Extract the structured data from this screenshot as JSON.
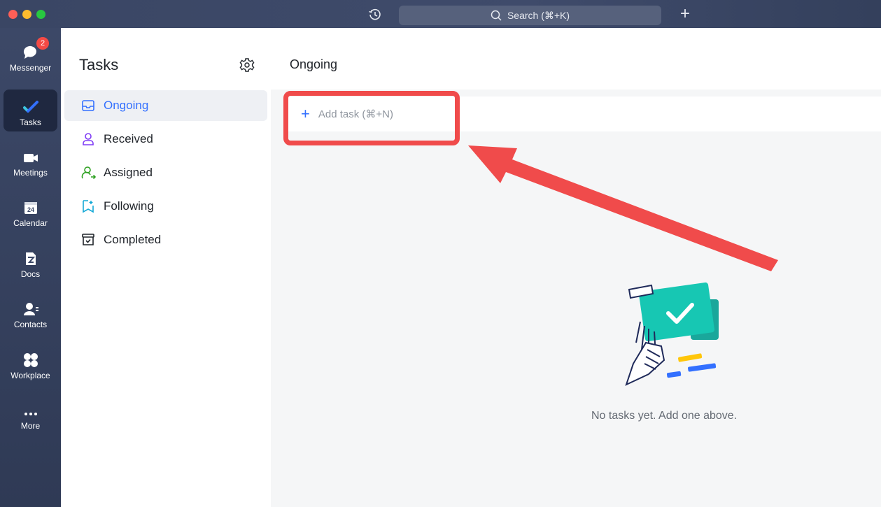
{
  "titlebar": {
    "search_label": "Search (⌘+K)",
    "icons": [
      "history-icon",
      "search-icon",
      "plus-icon"
    ]
  },
  "rail": {
    "items": [
      {
        "label": "Messenger",
        "icon": "messenger-icon",
        "badge": "2"
      },
      {
        "label": "Tasks",
        "icon": "tasks-icon",
        "active": true
      },
      {
        "label": "Meetings",
        "icon": "meetings-icon"
      },
      {
        "label": "Calendar",
        "icon": "calendar-icon",
        "icon_text": "24"
      },
      {
        "label": "Docs",
        "icon": "docs-icon"
      },
      {
        "label": "Contacts",
        "icon": "contacts-icon"
      },
      {
        "label": "Workplace",
        "icon": "workplace-icon"
      },
      {
        "label": "More",
        "icon": "more-icon"
      }
    ]
  },
  "panel": {
    "title": "Tasks",
    "items": [
      {
        "label": "Ongoing",
        "icon": "inbox-icon",
        "active": true
      },
      {
        "label": "Received",
        "icon": "person-icon"
      },
      {
        "label": "Assigned",
        "icon": "person-arrow-icon"
      },
      {
        "label": "Following",
        "icon": "bookmark-plus-icon"
      },
      {
        "label": "Completed",
        "icon": "archive-check-icon"
      }
    ]
  },
  "main": {
    "title": "Ongoing",
    "add_task_label": "Add task (⌘+N)",
    "empty_message": "No tasks yet. Add one above."
  },
  "colors": {
    "accent": "#3370ff",
    "highlight": "#f04b4b",
    "sidebar": "#3c4867"
  }
}
